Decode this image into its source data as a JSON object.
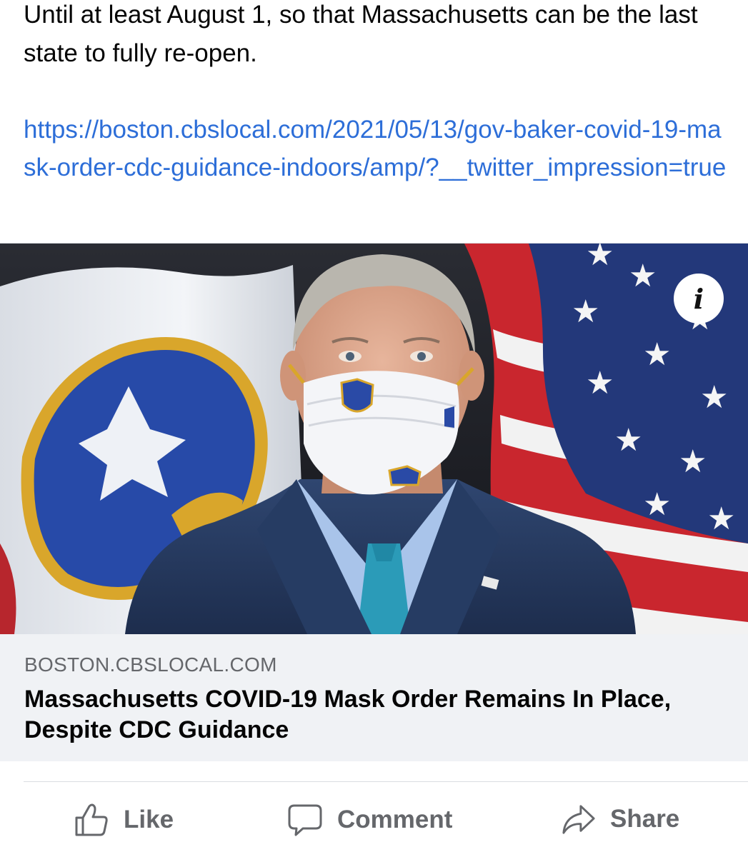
{
  "post": {
    "text": "Until at least August 1, so that Massachusetts can be the last state to fully re-open.",
    "link": "https://boston.cbslocal.com/2021/05/13/gov-baker-covid-19-mask-order-cdc-guidance-indoors/amp/?__twitter_impression=true"
  },
  "link_card": {
    "image_icon": "info-icon",
    "info_label": "i",
    "domain": "BOSTON.CBSLOCAL.COM",
    "title": "Massachusetts COVID-19 Mask Order Remains In Place, Despite CDC Guidance"
  },
  "actions": {
    "like_label": "Like",
    "comment_label": "Comment",
    "share_label": "Share"
  },
  "colors": {
    "link": "#2d6ed8",
    "action_gray": "#65676b",
    "card_background": "#f0f2f5"
  }
}
